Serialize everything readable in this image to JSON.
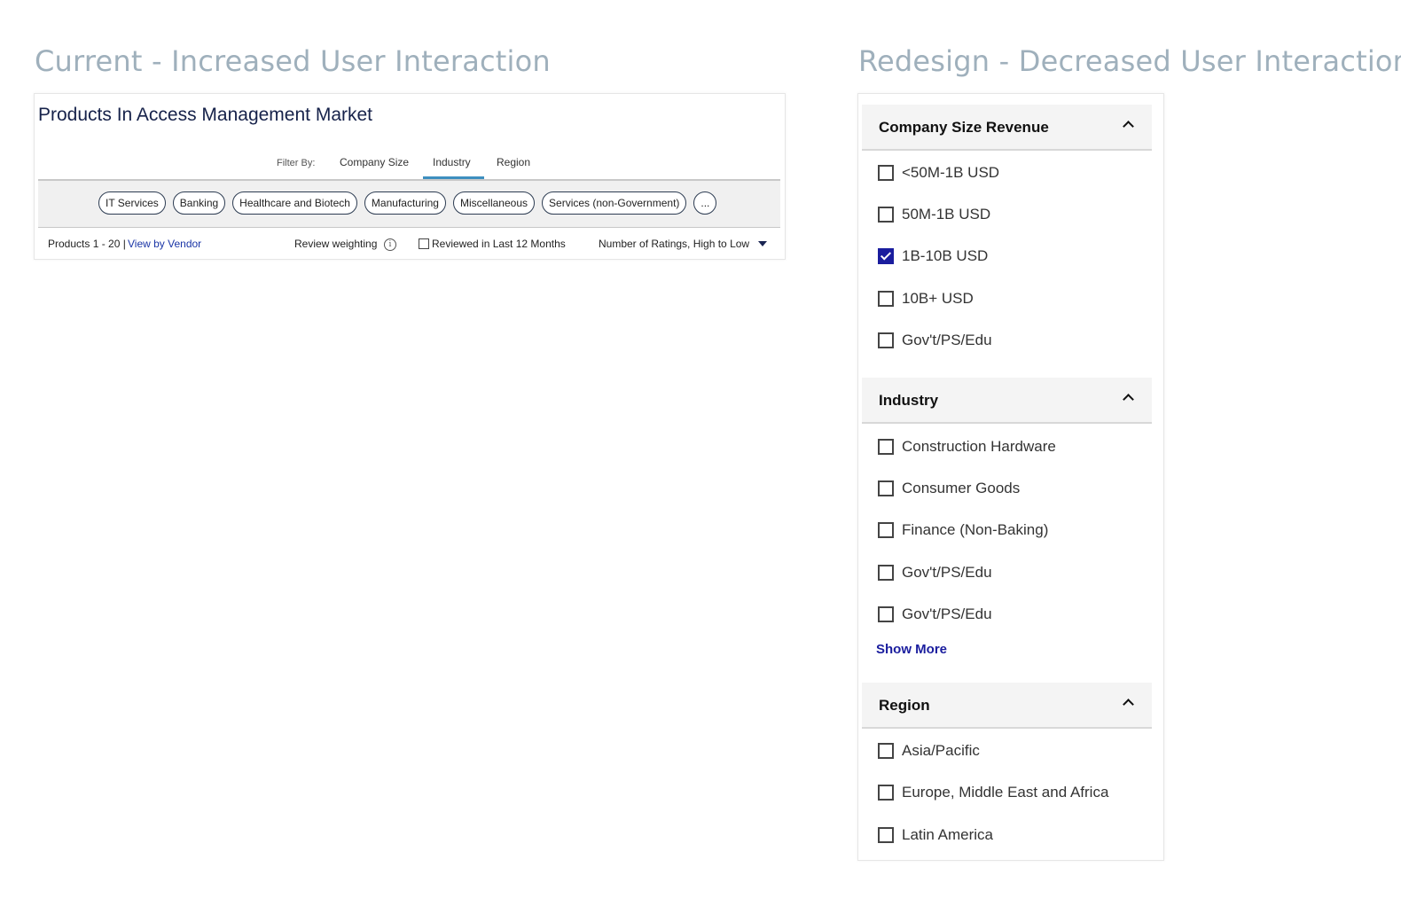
{
  "headings": {
    "current": "Current - Increased User Interaction",
    "redesign": "Redesign - Decreased User Interaction"
  },
  "current": {
    "title": "Products In Access Management Market",
    "filter_label": "Filter By:",
    "tabs": [
      "Company Size",
      "Industry",
      "Region"
    ],
    "active_tab": "Industry",
    "chips": [
      "IT Services",
      "Banking",
      "Healthcare and Biotech",
      "Manufacturing",
      "Miscellaneous",
      "Services (non-Government)",
      "..."
    ],
    "products_count": "Products 1 - 20 |",
    "view_by_vendor": "View by Vendor",
    "review_weighting": "Review weighting",
    "info_icon": "i",
    "reviewed_filter": "Reviewed in Last 12 Months",
    "reviewed_checked": false,
    "sort": "Number of Ratings, High to Low"
  },
  "redesign": {
    "sections": [
      {
        "title": "Company Size Revenue",
        "options": [
          {
            "label": "<50M-1B USD",
            "checked": false
          },
          {
            "label": "50M-1B USD",
            "checked": false
          },
          {
            "label": "1B-10B USD",
            "checked": true
          },
          {
            "label": "10B+ USD",
            "checked": false
          },
          {
            "label": "Gov't/PS/Edu",
            "checked": false
          }
        ]
      },
      {
        "title": "Industry",
        "options": [
          {
            "label": "Construction Hardware",
            "checked": false
          },
          {
            "label": "Consumer Goods",
            "checked": false
          },
          {
            "label": "Finance (Non-Baking)",
            "checked": false
          },
          {
            "label": "Gov't/PS/Edu",
            "checked": false
          },
          {
            "label": "Gov't/PS/Edu",
            "checked": false
          }
        ],
        "show_more": "Show More"
      },
      {
        "title": "Region",
        "options": [
          {
            "label": "Asia/Pacific",
            "checked": false
          },
          {
            "label": "Europe, Middle East and Africa",
            "checked": false
          },
          {
            "label": "Latin America",
            "checked": false
          }
        ]
      }
    ]
  },
  "colors": {
    "heading": "#9fb0bc",
    "title": "#16224a",
    "link": "#1a35a6",
    "checked": "#1a1d9e",
    "active_tab_underline": "#3d8fbf"
  }
}
